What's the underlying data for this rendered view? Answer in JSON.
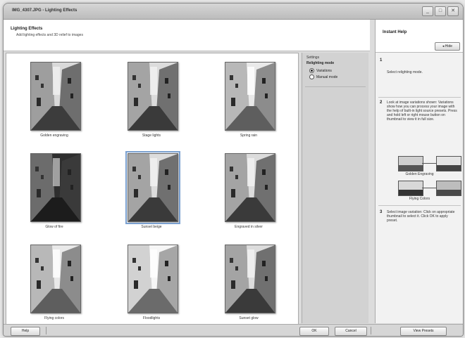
{
  "window": {
    "title": "IMG_4307.JPG - Lighting Effects",
    "minimize": "_",
    "maximize": "□",
    "close": "✕"
  },
  "header": {
    "title": "Lighting Effects",
    "subtitle": "Add lighting effects and 3D relief to images"
  },
  "thumbnails": [
    {
      "label": "Golden engraving",
      "tone": "warm"
    },
    {
      "label": "Stage lights",
      "tone": "normal"
    },
    {
      "label": "Spring rain",
      "tone": "light"
    },
    {
      "label": "Glow of fire",
      "tone": "dark"
    },
    {
      "label": "Sunset beige",
      "tone": "normal"
    },
    {
      "label": "Engraved in silver",
      "tone": "normal"
    },
    {
      "label": "Flying colors",
      "tone": "light"
    },
    {
      "label": "Floodlights",
      "tone": "bright"
    },
    {
      "label": "Sunset glow",
      "tone": "normal"
    }
  ],
  "settings": {
    "heading": "Settings",
    "mode_label": "Relighting mode",
    "options": [
      {
        "label": "Variations",
        "selected": true
      },
      {
        "label": "Manual mode",
        "selected": false
      }
    ]
  },
  "help": {
    "title": "Instant Help",
    "hide_label": "Hide",
    "steps": [
      {
        "num": "1",
        "text": "Select relighting mode."
      },
      {
        "num": "2",
        "text": "Look at image variations shown: Variations show how you can process your image with the help of built-in light source presets. Press and hold left or right mouse button on thumbnail to view it in full size."
      },
      {
        "num": "3",
        "text": "Select image variation: Click on appropriate thumbnail to select it. Click OK to apply preset."
      }
    ],
    "example_labels": [
      "Golden Engraving",
      "Flying Colors"
    ]
  },
  "footer": {
    "help": "Help",
    "ok": "OK",
    "cancel": "Cancel",
    "view_presets": "View Presets"
  }
}
